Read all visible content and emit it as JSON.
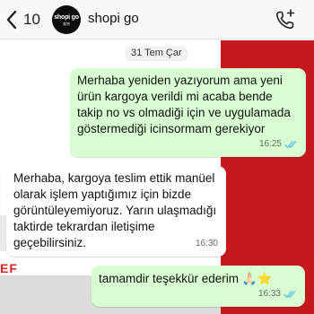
{
  "header": {
    "back_count": "10",
    "avatar_main": "shopi go",
    "avatar_sub": "美物",
    "chat_name": "shopi go"
  },
  "background": {
    "letters": "EF"
  },
  "date_chip": "31 Tem Çar",
  "messages": [
    {
      "direction": "outgoing",
      "text": "Merhaba yeniden yazıyorum ama yeni ürün kargoya verildi mi acaba bende takip no vs olmadiği için ve uygulamada göstermediği icinsormam gerekiyor",
      "time": "16:25",
      "status": "read"
    },
    {
      "direction": "incoming",
      "text": "Merhaba, kargoya teslim ettik manüel olarak işlem yaptığımız için bizde görüntüleyemiyoruz. Yarın ulaşmadığı taktirde tekrardan iletişime geçebilirsiniz.",
      "time": "16:30"
    },
    {
      "direction": "outgoing",
      "text": "tamamdir teşekkür ederim 🙏🏻⭐",
      "time": "16:33",
      "status": "read"
    }
  ],
  "colors": {
    "outgoing_bubble": "#d9fdd3",
    "incoming_bubble": "#ffffff",
    "check_color": "#53bdeb",
    "accent": "#c41a1e"
  }
}
